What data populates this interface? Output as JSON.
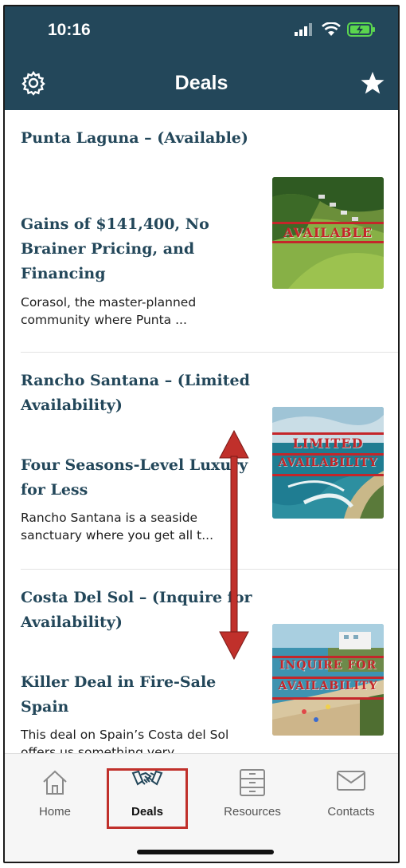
{
  "status": {
    "time": "10:16"
  },
  "nav": {
    "title": "Deals"
  },
  "deals": [
    {
      "heading": "Punta Laguna – (Available)",
      "title": "Gains of $141,400, No Brainer Pricing, and Financing",
      "description": "Corasol, the master-planned community where Punta ...",
      "badge_lines": [
        "AVAILABLE"
      ]
    },
    {
      "heading": "Rancho Santana – (Limited Availability)",
      "title": "Four Seasons-Level Luxury for Less",
      "description": "Rancho Santana is a seaside sanctuary where you get all t...",
      "badge_lines": [
        "LIMITED",
        "AVAILABILITY"
      ]
    },
    {
      "heading": "Costa Del Sol – (Inquire for Availability)",
      "title": "Killer Deal in Fire-Sale Spain",
      "description": "This deal on Spain’s Costa del Sol offers us something very",
      "badge_lines": [
        "INQUIRE FOR",
        "AVAILABILITY"
      ]
    }
  ],
  "tabs": [
    {
      "label": "Home",
      "icon": "home-icon"
    },
    {
      "label": "Deals",
      "icon": "handshake-icon",
      "active": true
    },
    {
      "label": "Resources",
      "icon": "cabinet-icon"
    },
    {
      "label": "Contacts",
      "icon": "mail-icon"
    }
  ],
  "colors": {
    "header": "#23475a",
    "accent": "#c0302b",
    "heading_text": "#23475a"
  }
}
